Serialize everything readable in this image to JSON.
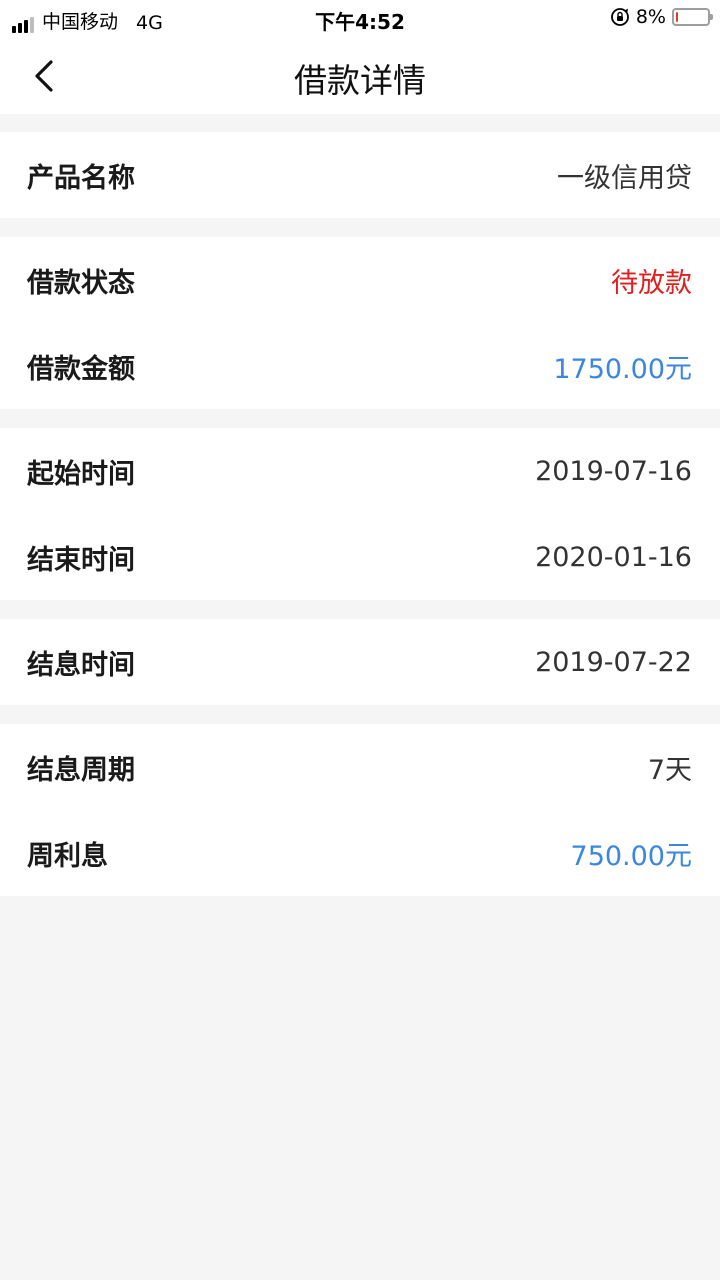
{
  "status_bar": {
    "carrier": "中国移动",
    "network": "4G",
    "time": "下午4:52",
    "battery": "8%",
    "battery_level": 0.08,
    "icons": [
      "signal-icon",
      "rotation-lock-icon",
      "battery-icon"
    ]
  },
  "nav": {
    "title": "借款详情",
    "back_icon": "chevron-left-icon"
  },
  "colors": {
    "status_pending": "#e02020",
    "amount_blue": "#3a86e0",
    "label": "#1a1a1a",
    "value_default": "#333333",
    "background": "#f5f5f5"
  },
  "groups": [
    [
      {
        "label": "产品名称",
        "value": "一级信用贷",
        "color": "#333333"
      }
    ],
    [
      {
        "label": "借款状态",
        "value": "待放款",
        "color": "#e02020"
      },
      {
        "label": "借款金额",
        "value": "1750.00元",
        "color": "#3a86e0"
      }
    ],
    [
      {
        "label": "起始时间",
        "value": "2019-07-16",
        "color": "#333333"
      },
      {
        "label": "结束时间",
        "value": "2020-01-16",
        "color": "#333333"
      }
    ],
    [
      {
        "label": "结息时间",
        "value": "2019-07-22",
        "color": "#333333"
      }
    ],
    [
      {
        "label": "结息周期",
        "value": "7天",
        "color": "#333333"
      },
      {
        "label": "周利息",
        "value": "750.00元",
        "color": "#3a86e0"
      }
    ]
  ]
}
